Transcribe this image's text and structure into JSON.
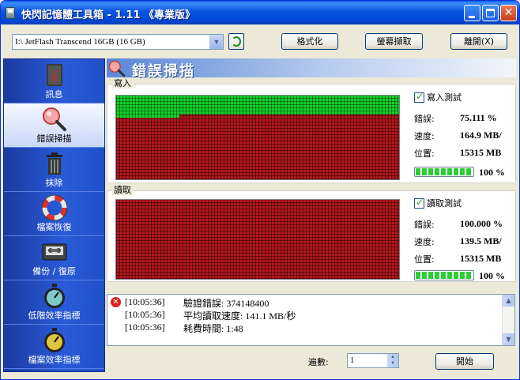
{
  "window": {
    "title": "快閃記憶體工具箱 - 1.11 《專業版》"
  },
  "toolbar": {
    "drive": "I:\\ JetFlash Transcend 16GB (16 GB)",
    "format_label": "格式化",
    "capture_label": "螢幕擷取",
    "exit_label": "離開(X)"
  },
  "sidebar": {
    "items": [
      {
        "label": "訊息",
        "icon": "info-icon"
      },
      {
        "label": "錯誤掃描",
        "icon": "magnifier-icon"
      },
      {
        "label": "抹除",
        "icon": "trash-icon"
      },
      {
        "label": "檔案恢復",
        "icon": "lifebuoy-icon"
      },
      {
        "label": "備份 / 復原",
        "icon": "tape-icon"
      },
      {
        "label": "低階效率指標",
        "icon": "stopwatch-icon"
      },
      {
        "label": "檔案效率指標",
        "icon": "stopwatch-icon"
      }
    ]
  },
  "header": {
    "title": "錯誤掃描"
  },
  "write": {
    "group_label": "寫入",
    "checkbox_label": "寫入測試",
    "error_label": "錯誤:",
    "error_value": "75.111 %",
    "speed_label": "速度:",
    "speed_value": "164.9 MB/",
    "position_label": "位置:",
    "position_value": "15315 MB",
    "progress_percent": 100,
    "progress_text": "100 %"
  },
  "read": {
    "group_label": "讀取",
    "checkbox_label": "讀取測試",
    "error_label": "錯誤:",
    "error_value": "100.000 %",
    "speed_label": "速度:",
    "speed_value": "139.5 MB/",
    "position_label": "位置:",
    "position_value": "15315 MB",
    "progress_percent": 100,
    "progress_text": "100 %"
  },
  "log": {
    "rows": [
      {
        "time": "[10:05:36]",
        "message": "驗證錯誤: 374148400",
        "error": true
      },
      {
        "time": "[10:05:36]",
        "message": "平均讀取速度: 141.1 MB/秒",
        "error": false
      },
      {
        "time": "[10:05:36]",
        "message": "耗費時間: 1:48",
        "error": false
      }
    ]
  },
  "footer": {
    "passes_label": "遍數:",
    "passes_value": "1",
    "start_label": "開始"
  },
  "colors": {
    "ok_block": "#12d32d",
    "bad_block": "#b3181d",
    "sidebar": "#2a5bd8"
  }
}
